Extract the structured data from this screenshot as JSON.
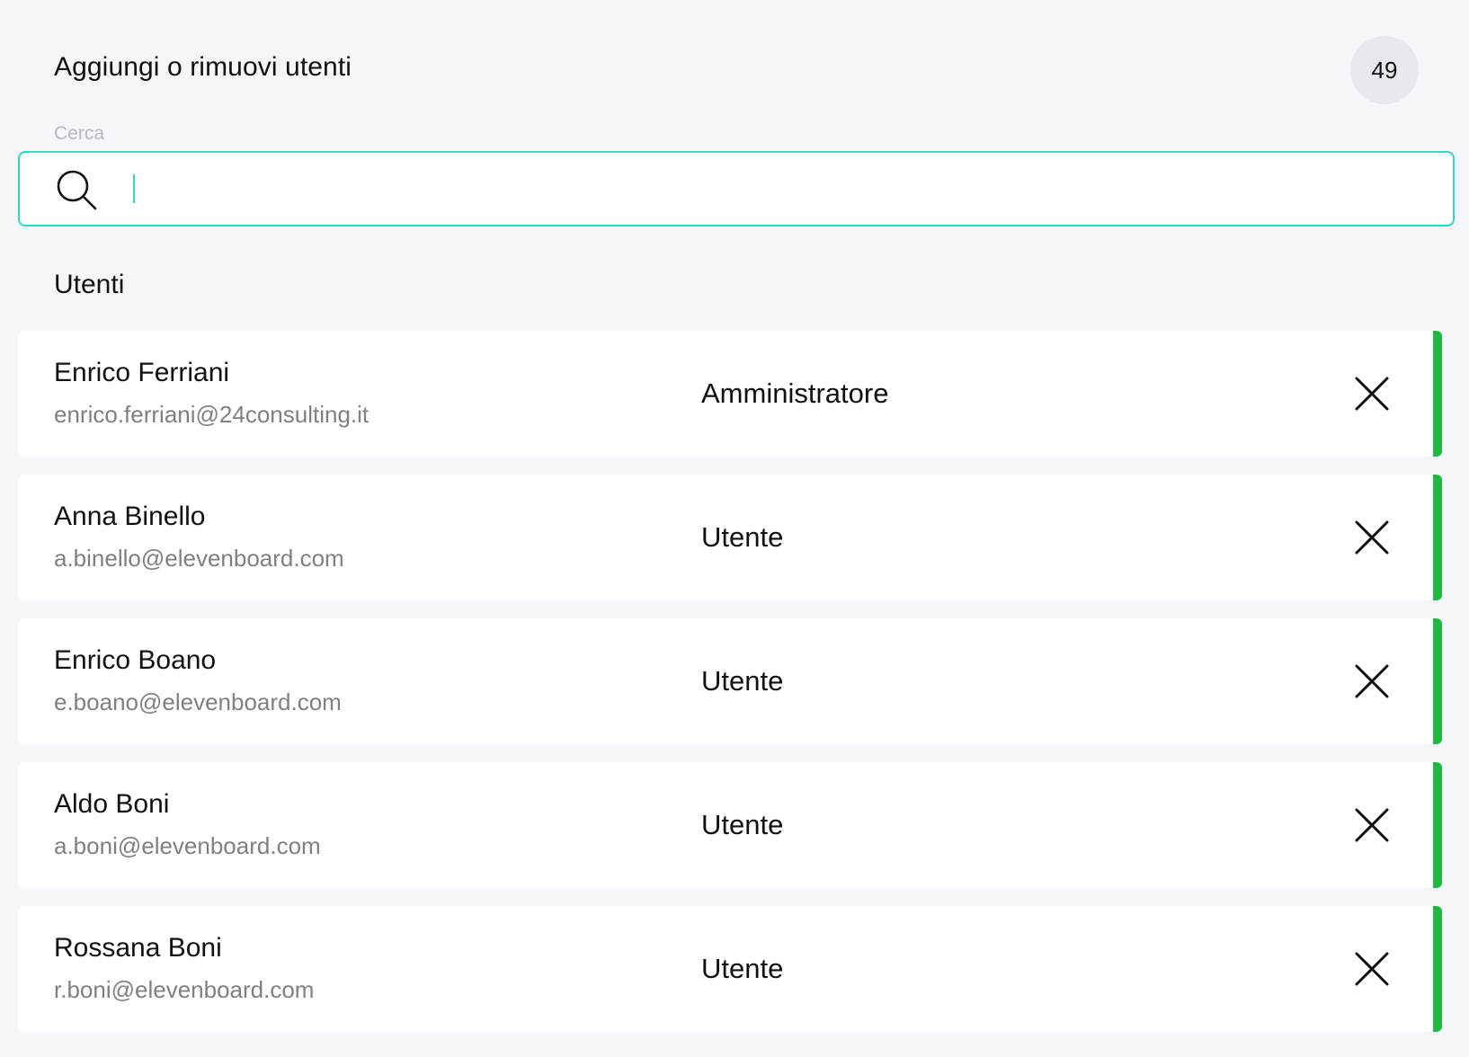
{
  "header": {
    "title": "Aggiungi o rimuovi utenti",
    "count": "49"
  },
  "search": {
    "label": "Cerca",
    "value": "",
    "placeholder": "",
    "icon": "search-icon"
  },
  "colors": {
    "accent": "#2bd9c6",
    "row_indicator": "#1fb845",
    "background": "#f5f6f9"
  },
  "users_section": {
    "title": "Utenti",
    "users": [
      {
        "name": "Enrico Ferriani",
        "email": "enrico.ferriani@24consulting.it",
        "role": "Amministratore"
      },
      {
        "name": "Anna Binello",
        "email": "a.binello@elevenboard.com",
        "role": "Utente"
      },
      {
        "name": "Enrico Boano",
        "email": "e.boano@elevenboard.com",
        "role": "Utente"
      },
      {
        "name": "Aldo Boni",
        "email": "a.boni@elevenboard.com",
        "role": "Utente"
      },
      {
        "name": "Rossana Boni",
        "email": "r.boni@elevenboard.com",
        "role": "Utente"
      }
    ],
    "remove_icon": "close-icon"
  }
}
